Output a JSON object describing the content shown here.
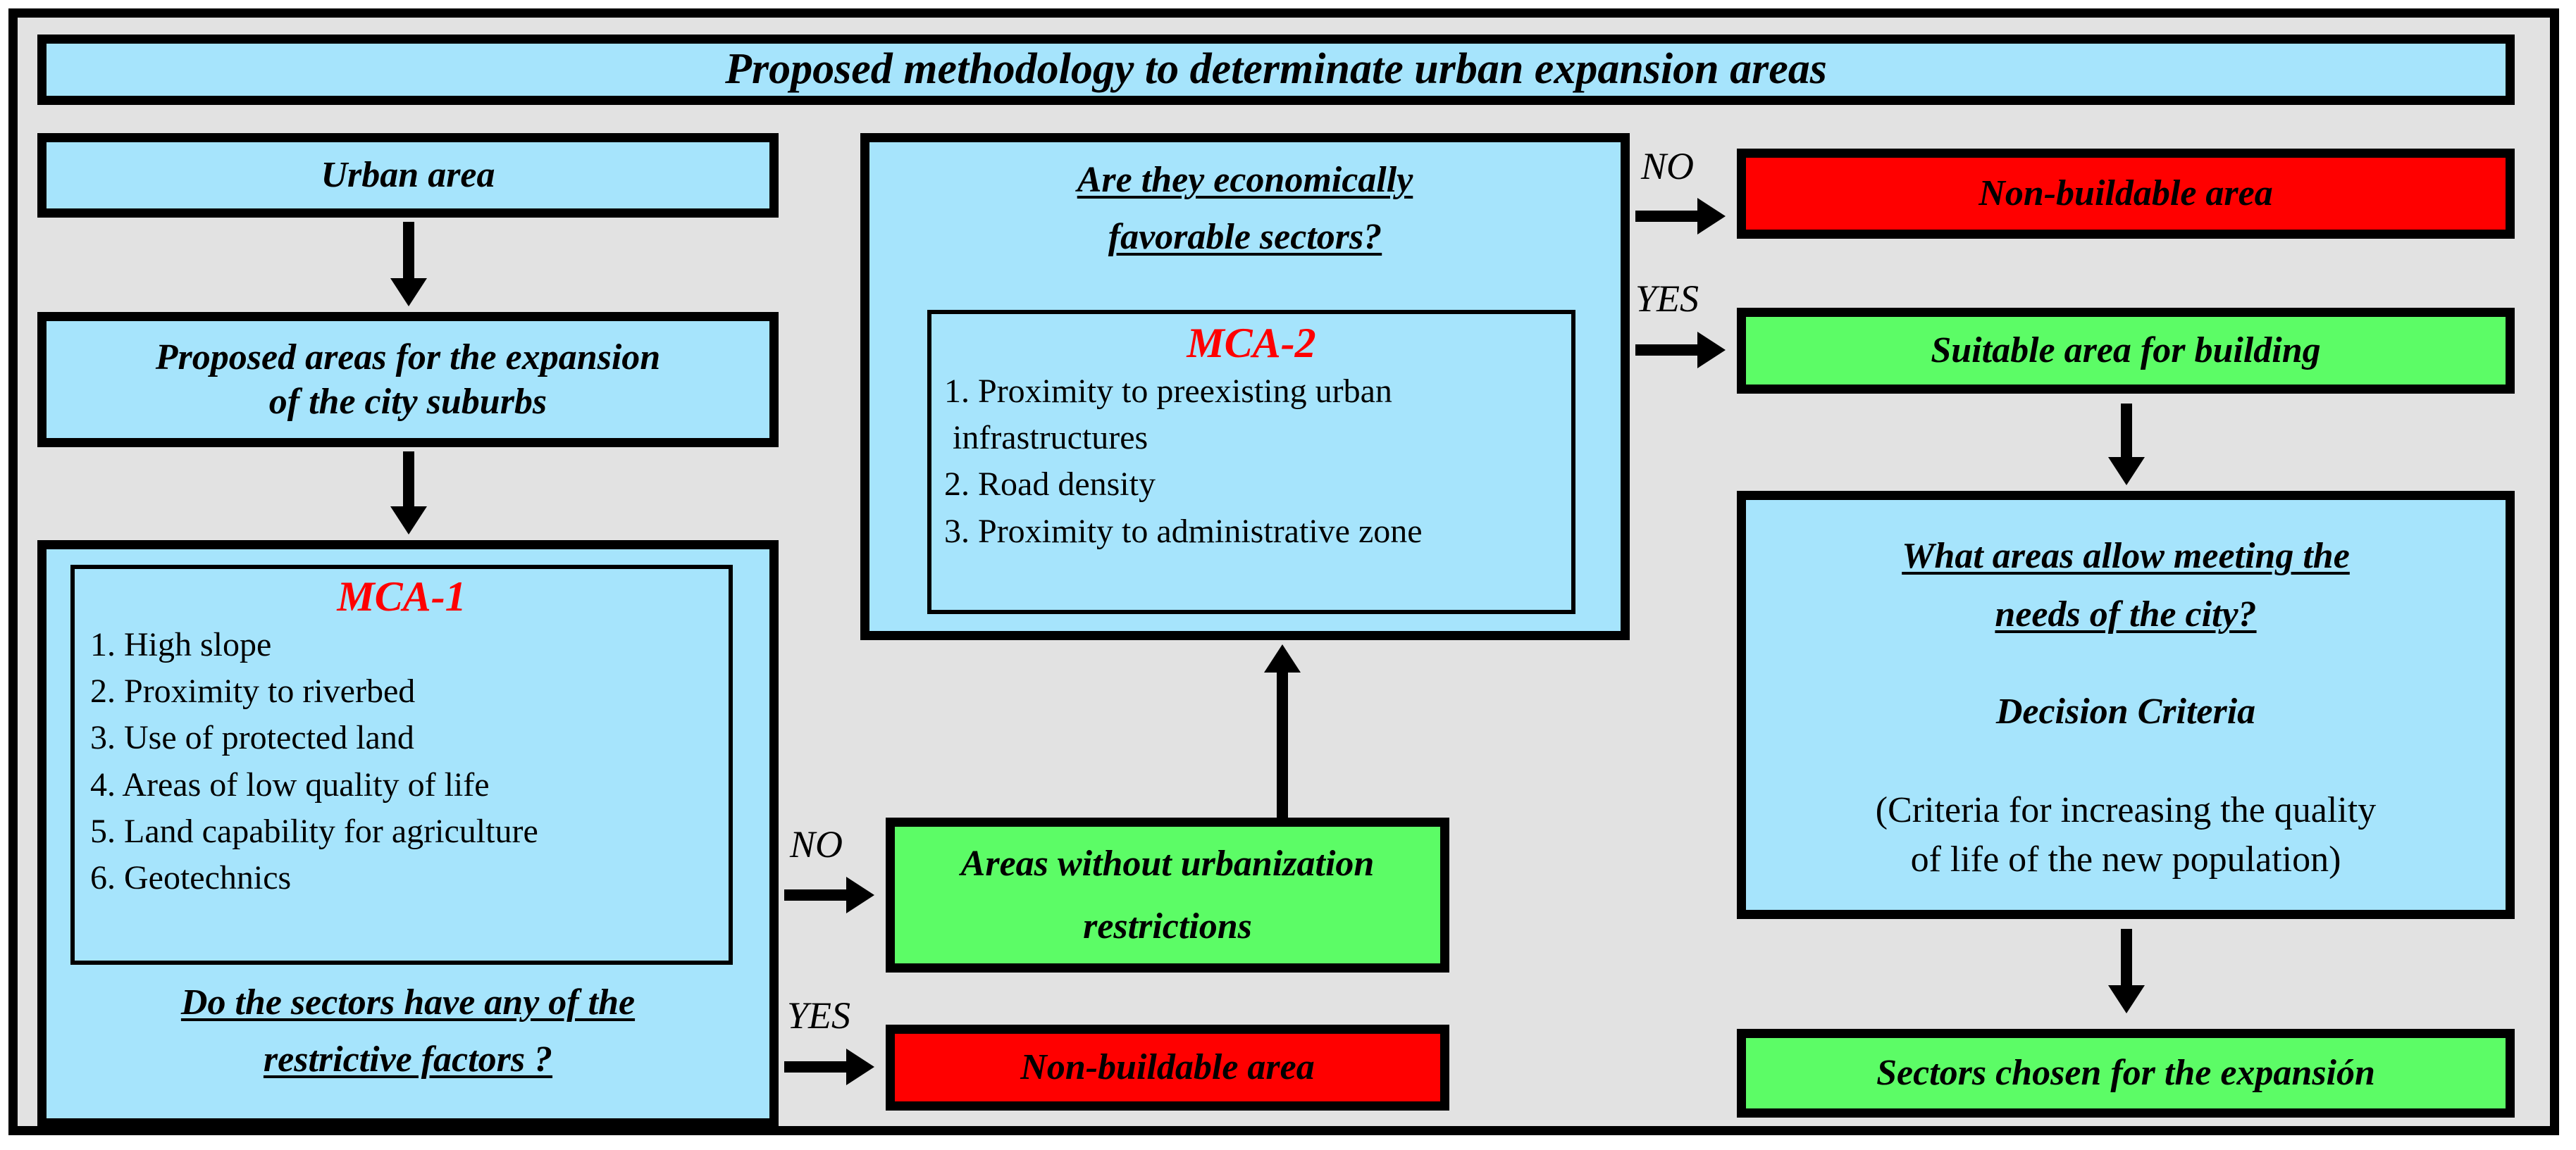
{
  "diagram": {
    "title": "Proposed methodology to determinate urban expansion areas",
    "colors": {
      "background": "#e2e2e2",
      "box_fill_blue": "#a6e4fc",
      "box_fill_green": "#5cfc66",
      "box_fill_red": "#ff0000",
      "border": "#000000",
      "mca_label": "#ff0000"
    },
    "nodes": {
      "urban_area": "Urban area",
      "proposed_areas": "Proposed areas for the expansion\nof the city suburbs",
      "mca1_label": "MCA-1",
      "mca1_criteria": [
        "1. High slope",
        "2. Proximity to riverbed",
        "3. Use of protected land",
        "4. Areas of low quality of life",
        "5. Land capability for agriculture",
        "6. Geotechnics"
      ],
      "mca1_question_line1": "Do the sectors have any of the",
      "mca1_question_line2": "restrictive factors ?",
      "mca2_question_line1": "Are they economically",
      "mca2_question_line2": "favorable sectors?",
      "mca2_label": "MCA-2",
      "mca2_criteria": [
        "1. Proximity to preexisting urban",
        " infrastructures",
        "2. Road density",
        "3. Proximity to administrative zone"
      ],
      "areas_without_restrictions_line1": "Areas without urbanization",
      "areas_without_restrictions_line2": "restrictions",
      "non_buildable_bottom": "Non-buildable area",
      "non_buildable_top": "Non-buildable area",
      "suitable_area": "Suitable area for building",
      "needs_question_line1": "What areas allow meeting the",
      "needs_question_line2": "needs of the city?",
      "decision_criteria": "Decision Criteria",
      "decision_note_line1": "(Criteria for increasing the quality",
      "decision_note_line2": "of life of the new population)",
      "sectors_chosen": "Sectors chosen for the expansión"
    },
    "branch_labels": {
      "mca1_no": "NO",
      "mca1_yes": "YES",
      "mca2_no": "NO",
      "mca2_yes": "YES"
    }
  }
}
